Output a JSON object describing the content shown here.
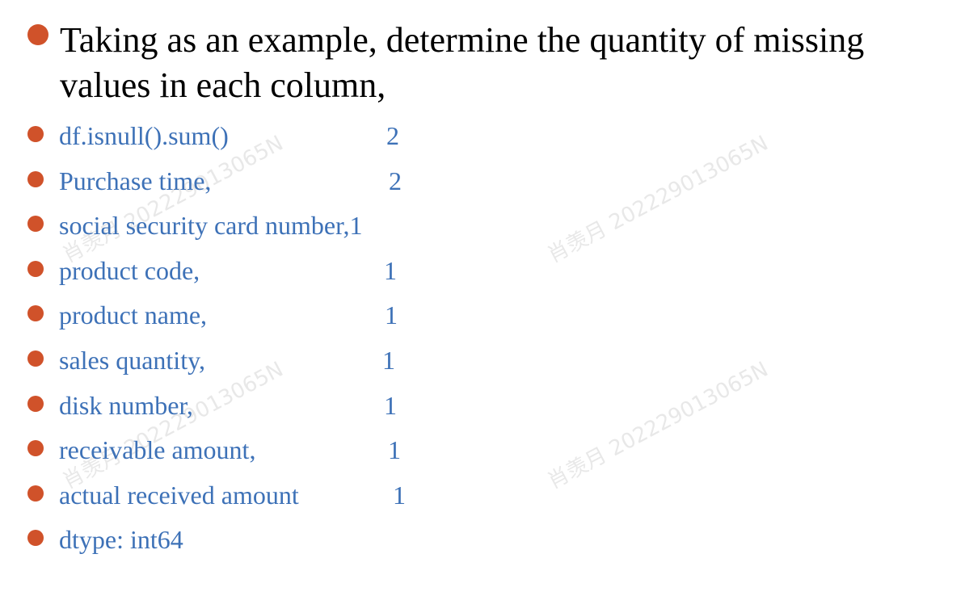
{
  "heading": {
    "text": "Taking as an example, determine the quantity of missing values in each column,"
  },
  "items": [
    {
      "label": "df.isnull().sum()",
      "count": "2"
    },
    {
      "label": "Purchase time,",
      "count": "2"
    },
    {
      "label": "social security card number,1",
      "count": ""
    },
    {
      "label": "product code,",
      "count": "1"
    },
    {
      "label": "product name,",
      "count": "1"
    },
    {
      "label": "sales quantity,",
      "count": "1"
    },
    {
      "label": "disk number,",
      "count": "1"
    },
    {
      "label": "receivable amount,",
      "count": "1"
    },
    {
      "label": "actual received amount",
      "count": "1"
    },
    {
      "label": "dtype: int64",
      "count": ""
    }
  ],
  "watermark": {
    "text": "肖羡月 202229013065N"
  },
  "colors": {
    "bullet": "#d0522a",
    "body_text": "#3d71b7",
    "heading_text": "#000000"
  }
}
